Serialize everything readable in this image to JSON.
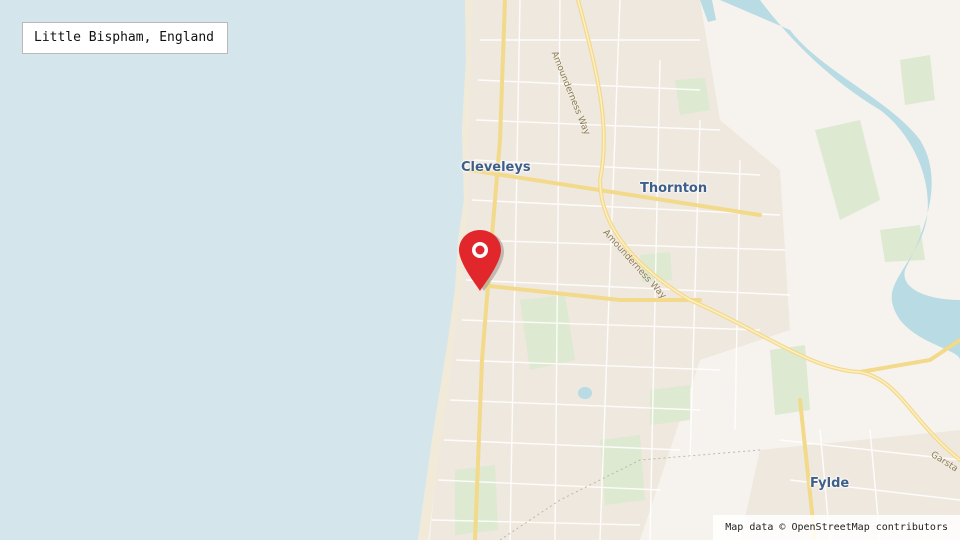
{
  "location_label": "Little Bispham, England",
  "attribution": "Map data ©  OpenStreetMap contributors",
  "places": {
    "cleveleys": "Cleveleys",
    "thornton": "Thornton",
    "fylde": "Fylde"
  },
  "roads": {
    "amounderness_north": "Amounderness Way",
    "amounderness_south": "Amounderness Way",
    "garstang": "Garsta"
  },
  "colors": {
    "sea": "#d4e6eb",
    "land": "#f6f3ee",
    "urban": "#efe9e1",
    "park": "#d9e8cd",
    "major_road": "#f7de8f",
    "river": "#b9dbe3",
    "pin": "#e1272b"
  },
  "icons": {
    "pin": "map-pin-icon"
  }
}
